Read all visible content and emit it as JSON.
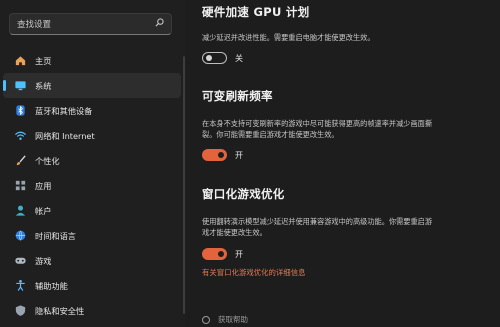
{
  "search": {
    "placeholder": "查找设置"
  },
  "nav": {
    "items": [
      {
        "label": "主页",
        "icon": "home-icon",
        "color": "#e8a25a"
      },
      {
        "label": "系统",
        "icon": "system-icon",
        "color": "#4cc2ff",
        "active": true
      },
      {
        "label": "蓝牙和其他设备",
        "icon": "bluetooth-icon",
        "color": "#4aa3ff"
      },
      {
        "label": "网络和 Internet",
        "icon": "wifi-icon",
        "color": "#4cc2ff"
      },
      {
        "label": "个性化",
        "icon": "brush-icon",
        "color": "#e7a25c"
      },
      {
        "label": "应用",
        "icon": "apps-icon",
        "color": "#9aa4b0"
      },
      {
        "label": "帐户",
        "icon": "account-icon",
        "color": "#3fb0c9"
      },
      {
        "label": "时间和语言",
        "icon": "globe-clock-icon",
        "color": "#4cc2ff"
      },
      {
        "label": "游戏",
        "icon": "gamepad-icon",
        "color": "#b0b8c2"
      },
      {
        "label": "辅助功能",
        "icon": "accessibility-icon",
        "color": "#5fb7ff"
      },
      {
        "label": "隐私和安全性",
        "icon": "shield-icon",
        "color": "#9aa4b0"
      }
    ]
  },
  "settings": {
    "gpu": {
      "title": "硬件加速 GPU 计划",
      "description": "减少延迟并改进性能。需要重启电脑才能使更改生效。",
      "toggle_label": "关",
      "state": "off"
    },
    "vrr": {
      "title": "可变刷新频率",
      "description_line1": "在本身不支持可变刷新率的游戏中尽可能获得更高的帧速率并减少画面撕",
      "description_line2": "裂。你可能需要重启游戏才能使更改生效。",
      "toggle_label": "开",
      "state": "on"
    },
    "windowed": {
      "title": "窗口化游戏优化",
      "description_line1": "使用翻转演示模型减少延迟并使用兼容游戏中的高级功能。你需要重启游",
      "description_line2": "戏才能使更改生效。",
      "toggle_label": "开",
      "state": "on",
      "link": "有关窗口化游戏优化的详细信息"
    }
  },
  "footer": {
    "help_label": "获取帮助"
  },
  "colors": {
    "accent_on": "#e3633d",
    "link": "#e37c56",
    "nav_accent": "#4cc2ff"
  }
}
